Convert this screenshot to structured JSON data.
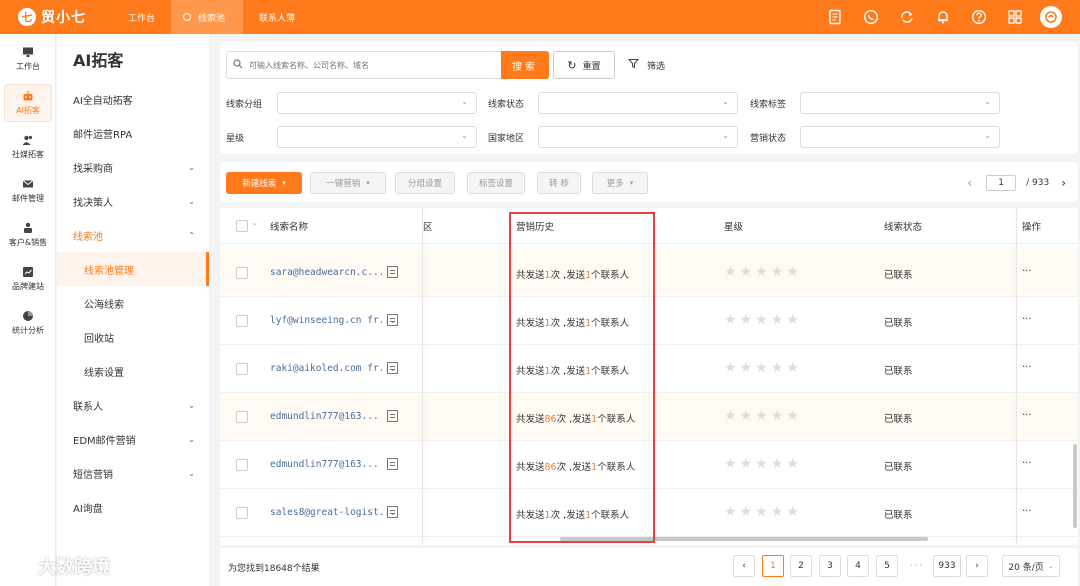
{
  "app": {
    "logo_char": "七",
    "name": "贸小七"
  },
  "topnav": [
    {
      "label": "工作台"
    },
    {
      "label": "线索池"
    },
    {
      "label": "联系人薄"
    }
  ],
  "rail": [
    {
      "label": "工作台",
      "icon": "monitor-icon"
    },
    {
      "label": "AI拓客",
      "icon": "robot-icon"
    },
    {
      "label": "社媒拓客",
      "icon": "people-icon"
    },
    {
      "label": "邮件管理",
      "icon": "mail-icon"
    },
    {
      "label": "客户&销售",
      "icon": "customer-icon"
    },
    {
      "label": "品牌建站",
      "icon": "chart-icon"
    },
    {
      "label": "统计分析",
      "icon": "pie-icon"
    }
  ],
  "menu": {
    "title": "AI拓客",
    "items": [
      {
        "label": "AI全自动拓客"
      },
      {
        "label": "邮件运营RPA"
      },
      {
        "label": "找采购商"
      },
      {
        "label": "找决策人"
      },
      {
        "label": "线索池"
      },
      {
        "label": "线索池管理"
      },
      {
        "label": "公海线索"
      },
      {
        "label": "回收站"
      },
      {
        "label": "线索设置"
      },
      {
        "label": "联系人"
      },
      {
        "label": "EDM邮件营销"
      },
      {
        "label": "短信营销"
      },
      {
        "label": "AI询盘"
      }
    ]
  },
  "search": {
    "placeholder": "可输入线索名称、公司名称、域名",
    "button": "搜索",
    "reset": "重置",
    "filter": "筛选"
  },
  "filters": [
    {
      "label": "线索分组"
    },
    {
      "label": "线索状态"
    },
    {
      "label": "线索标签"
    },
    {
      "label": "星级"
    },
    {
      "label": "国家地区"
    },
    {
      "label": "营销状态"
    }
  ],
  "toolbar": {
    "new_lead": "新建线索",
    "buttons": [
      "一键营销",
      "分组设置",
      "标签设置",
      "转 移",
      "更多"
    ],
    "page_current": "1",
    "page_total": "/  933"
  },
  "table": {
    "headers": {
      "name": "线索名称",
      "region": "区",
      "history": "营销历史",
      "stars": "星级",
      "status": "线索状态",
      "ops": "操作"
    },
    "rows": [
      {
        "name": "sara@headwearcn.c...",
        "h1": "共发送",
        "h2": "1",
        "h3": "次 ,发送",
        "h4": "1",
        "h5": "个联系人",
        "status": "已联系",
        "stars": 0,
        "ops": "..."
      },
      {
        "name": "lyf@winseeing.cn fr...",
        "h1": "共发送",
        "h2": "1",
        "h3": "次 ,发送",
        "h4": "1",
        "h5": "个联系人",
        "status": "已联系",
        "stars": 0,
        "ops": "..."
      },
      {
        "name": "raki@aikoled.com fr...",
        "h1": "共发送",
        "h2": "1",
        "h3": "次 ,发送",
        "h4": "1",
        "h5": "个联系人",
        "status": "已联系",
        "stars": 0,
        "ops": "..."
      },
      {
        "name": "edmundlin777@163...",
        "h1": "共发送",
        "h2": "86",
        "h3": "次 ,发送",
        "h4": "1",
        "h5": "个联系人",
        "status": "已联系",
        "stars": 0,
        "ops": "..."
      },
      {
        "name": "edmundlin777@163...",
        "h1": "共发送",
        "h2": "86",
        "h3": "次 ,发送",
        "h4": "1",
        "h5": "个联系人",
        "status": "已联系",
        "stars": 0,
        "ops": "..."
      },
      {
        "name": "sales8@great-logist...",
        "h1": "共发送",
        "h2": "1",
        "h3": "次 ,发送",
        "h4": "1",
        "h5": "个联系人",
        "status": "已联系",
        "stars": 0,
        "ops": "..."
      }
    ]
  },
  "footer": {
    "total": "为您找到18648个结果",
    "pages": [
      "1",
      "2",
      "3",
      "4",
      "5"
    ],
    "ellipsis": "···",
    "last": "933",
    "page_size": "20 条/页"
  },
  "watermark": "大数跨境",
  "colors": {
    "brand": "#ff7a1a",
    "highlight_box": "#e64040",
    "link": "#4a6d9c"
  }
}
